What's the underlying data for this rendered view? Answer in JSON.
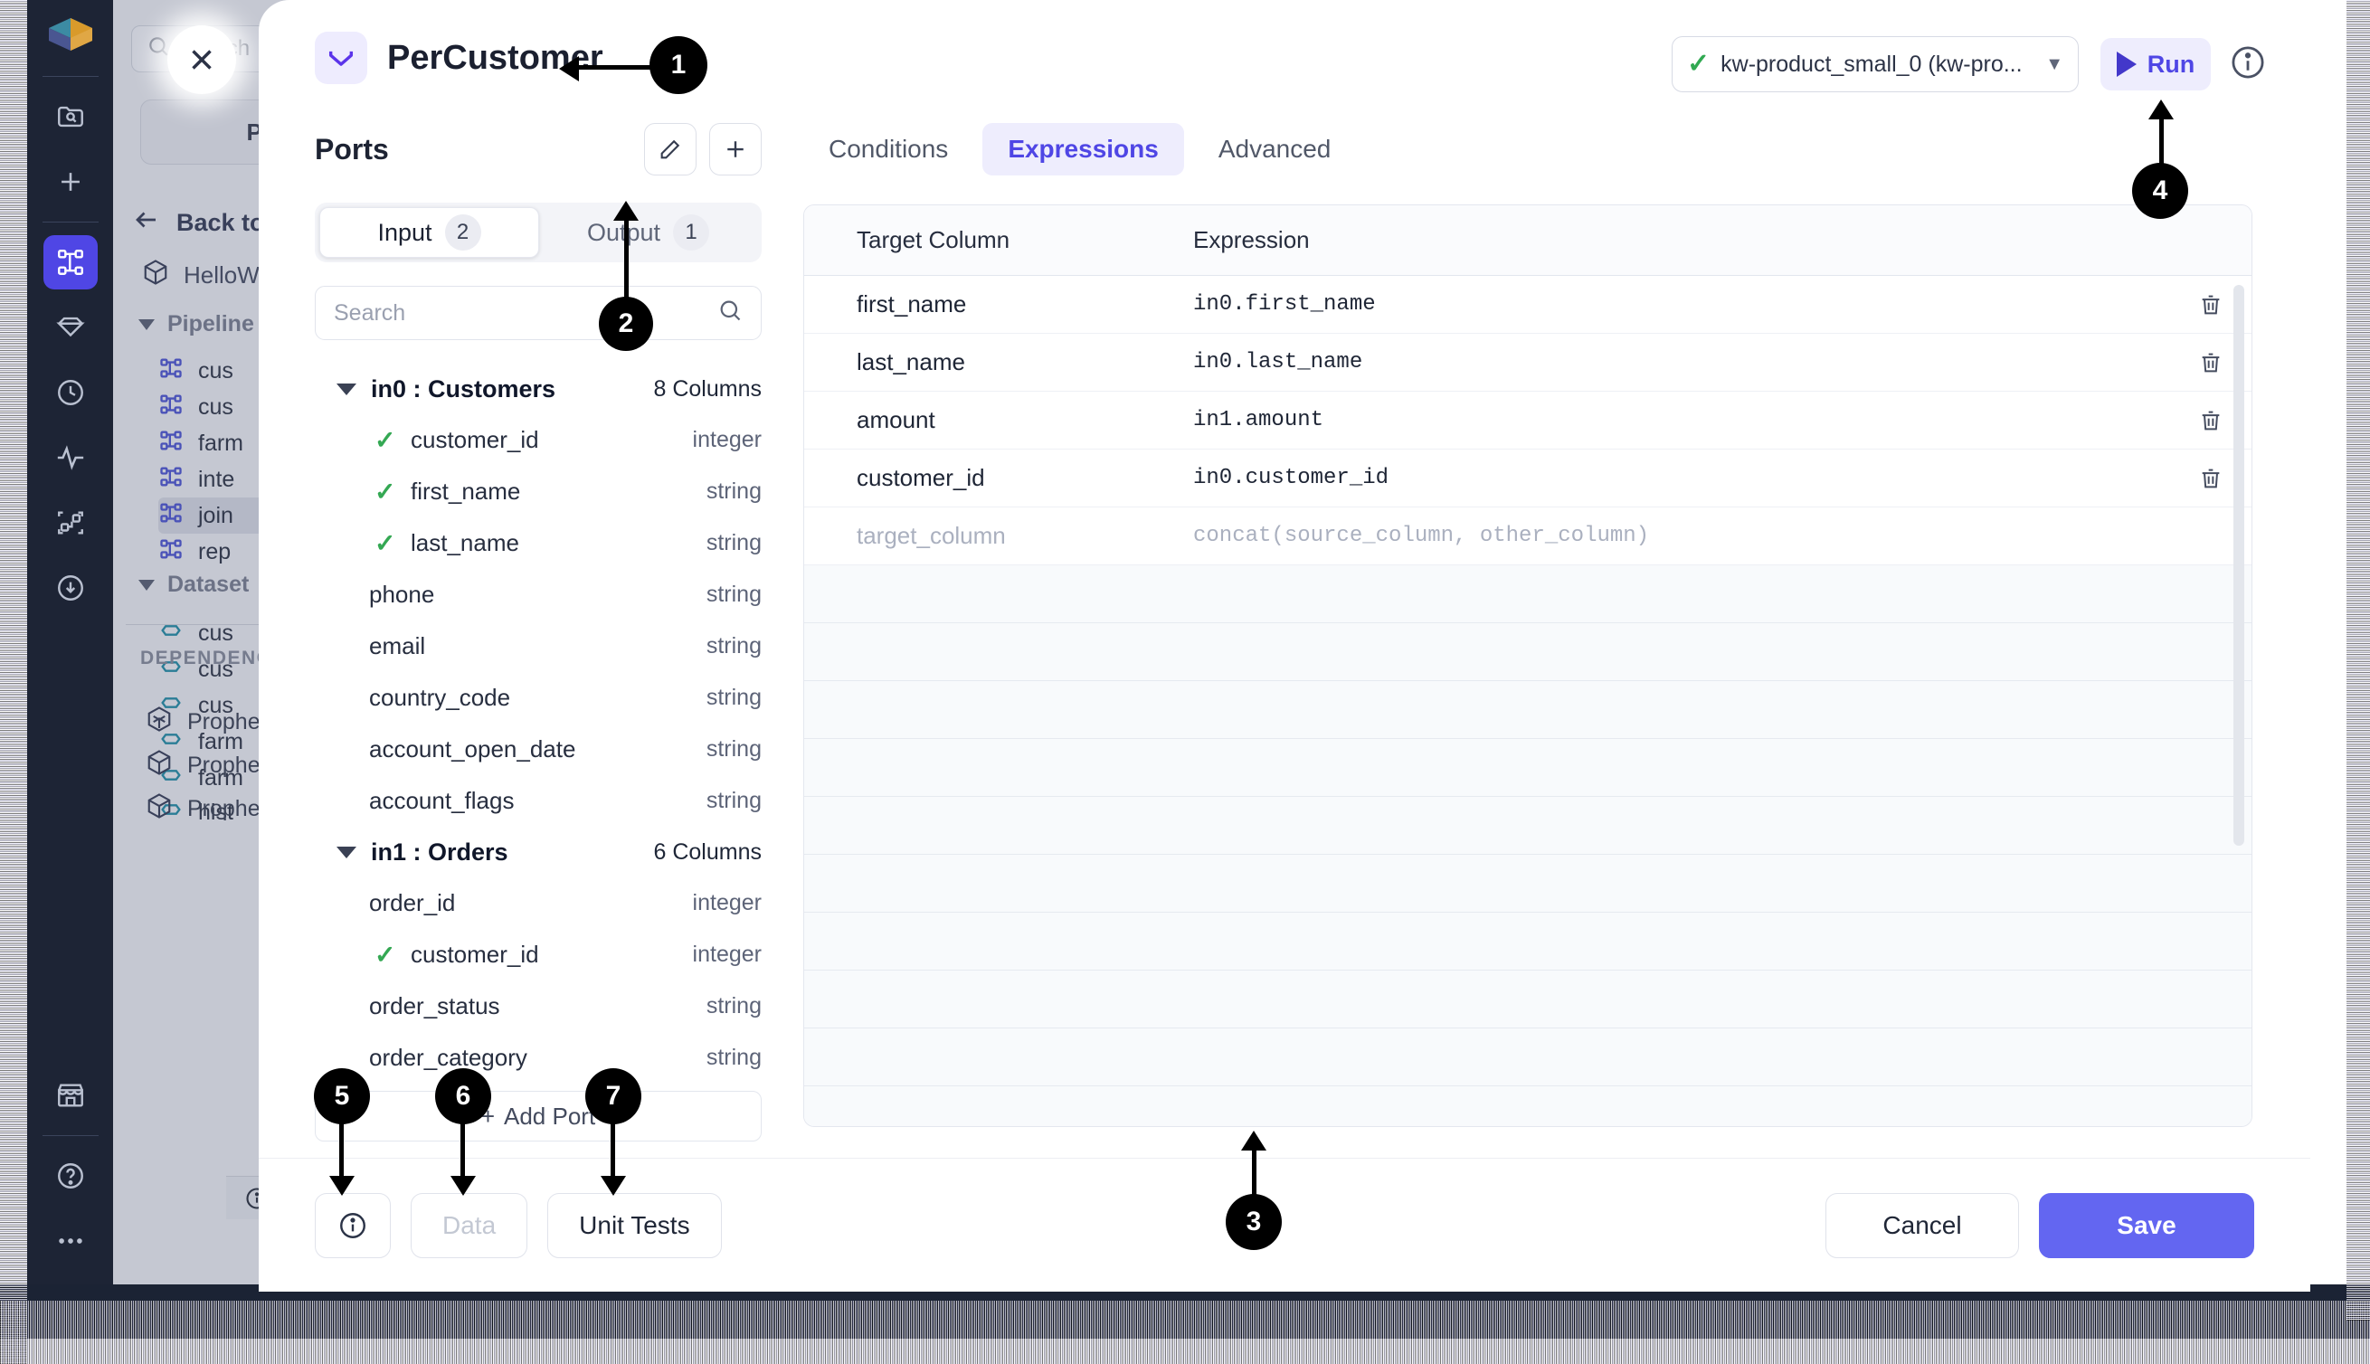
{
  "background": {
    "search_placeholder": "Search",
    "project_button": "Proje",
    "back_label": "Back to",
    "root_item": "HelloW",
    "groups": [
      {
        "label": "Pipeline",
        "items": [
          "cus",
          "cus",
          "farm",
          "inte",
          "join",
          "rep"
        ]
      },
      {
        "label": "Dataset",
        "items": [
          "cus",
          "cus",
          "cus",
          "farm",
          "farm",
          "hist"
        ]
      }
    ],
    "dependencies_label": "DEPENDENC",
    "dependencies": [
      "Prophe",
      "Prophe",
      "Prophe"
    ]
  },
  "modal": {
    "title": "PerCustomer",
    "close_label": "×",
    "env_select": {
      "value": "kw-product_small_0 (kw-pro...",
      "status": "connected"
    },
    "run_label": "Run"
  },
  "ports": {
    "title": "Ports",
    "tabs": [
      {
        "label": "Input",
        "count": "2",
        "active": true
      },
      {
        "label": "Output",
        "count": "1",
        "active": false
      }
    ],
    "search_placeholder": "Search",
    "add_port_label": "Add Port",
    "groups": [
      {
        "name": "in0 : Customers",
        "columns_label": "8 Columns",
        "columns": [
          {
            "name": "customer_id",
            "type": "integer",
            "selected": true
          },
          {
            "name": "first_name",
            "type": "string",
            "selected": true
          },
          {
            "name": "last_name",
            "type": "string",
            "selected": true
          },
          {
            "name": "phone",
            "type": "string",
            "selected": false
          },
          {
            "name": "email",
            "type": "string",
            "selected": false
          },
          {
            "name": "country_code",
            "type": "string",
            "selected": false
          },
          {
            "name": "account_open_date",
            "type": "string",
            "selected": false
          },
          {
            "name": "account_flags",
            "type": "string",
            "selected": false
          }
        ]
      },
      {
        "name": "in1 : Orders",
        "columns_label": "6 Columns",
        "columns": [
          {
            "name": "order_id",
            "type": "integer",
            "selected": false
          },
          {
            "name": "customer_id",
            "type": "integer",
            "selected": true
          },
          {
            "name": "order_status",
            "type": "string",
            "selected": false
          },
          {
            "name": "order_category",
            "type": "string",
            "selected": false
          }
        ]
      }
    ]
  },
  "expressions": {
    "tabs": [
      {
        "label": "Conditions",
        "active": false
      },
      {
        "label": "Expressions",
        "active": true
      },
      {
        "label": "Advanced",
        "active": false
      }
    ],
    "headers": {
      "target": "Target Column",
      "expression": "Expression"
    },
    "rows": [
      {
        "target": "first_name",
        "expression": "in0.first_name",
        "ghost": false
      },
      {
        "target": "last_name",
        "expression": "in0.last_name",
        "ghost": false
      },
      {
        "target": "amount",
        "expression": "in1.amount",
        "ghost": false
      },
      {
        "target": "customer_id",
        "expression": "in0.customer_id",
        "ghost": false
      },
      {
        "target": "target_column",
        "expression": "concat(source_column, other_column)",
        "ghost": true
      }
    ],
    "empty_row_count": 12
  },
  "footer": {
    "info_label": "i",
    "data_label": "Data",
    "unit_tests_label": "Unit Tests",
    "cancel_label": "Cancel",
    "save_label": "Save"
  },
  "annotations": [
    {
      "id": "1",
      "number": "1"
    },
    {
      "id": "2",
      "number": "2"
    },
    {
      "id": "3",
      "number": "3"
    },
    {
      "id": "4",
      "number": "4"
    },
    {
      "id": "5",
      "number": "5"
    },
    {
      "id": "6",
      "number": "6"
    },
    {
      "id": "7",
      "number": "7"
    }
  ],
  "colors": {
    "accent": "#4f46e5",
    "primary_button": "#6366f1",
    "sidebar": "#1d2435",
    "success": "#34a853"
  }
}
